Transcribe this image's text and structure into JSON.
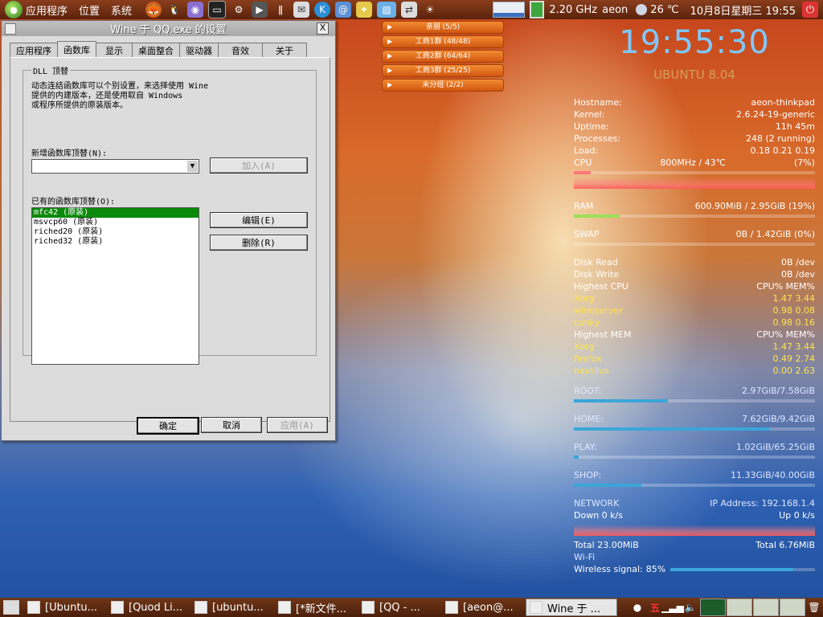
{
  "top_panel": {
    "menus": [
      "应用程序",
      "位置",
      "系统"
    ],
    "cpu_freq": "2.20 GHz",
    "user": "aeon",
    "temperature": "26 ℃",
    "datetime": "10月8日星期三 19:55"
  },
  "dialog": {
    "title": "Wine 于 QQ.exe 的设置",
    "close_label": "X",
    "tabs": [
      "应用程序",
      "函数库",
      "显示",
      "桌面整合",
      "驱动器",
      "音效",
      "关于"
    ],
    "group_label": "DLL 顶替",
    "description": [
      "动态连结函数库可以个别设置，来选择使用 Wine",
      "提供的内建版本，还是使用取自 Windows",
      "或程序所提供的原装版本。"
    ],
    "new_label": "新增函数库顶替(N):",
    "combo_value": "",
    "add_button": "加入(A)",
    "existing_label": "已有的函数库顶替(O):",
    "existing": [
      "mfc42 (原装)",
      "msvcp60 (原装)",
      "riched20 (原装)",
      "riched32 (原装)"
    ],
    "edit_button": "编辑(E)",
    "delete_button": "删除(R)",
    "ok_button": "确定",
    "cancel_button": "取消",
    "apply_button": "应用(A)"
  },
  "qq_groups": [
    "亲朋 (5/5)",
    "工商1群 (48/48)",
    "工商2群 (64/64)",
    "工商3群 (25/25)",
    "未分组 (2/2)"
  ],
  "conky": {
    "clock": "19:55:30",
    "distro": "UBUNTU 8.04",
    "hostname": {
      "label": "Hostname:",
      "value": "aeon-thinkpad"
    },
    "kernel": {
      "label": "Kernel:",
      "value": "2.6.24-19-generic"
    },
    "uptime": {
      "label": "Uptime:",
      "value": "11h 45m"
    },
    "processes": {
      "label": "Processes:",
      "value": "248 (2 running)"
    },
    "load": {
      "label": "Load:",
      "value": "0.18 0.21 0.19"
    },
    "cpu": {
      "label": "CPU",
      "value": "800MHz / 43℃",
      "percent": "(7%)",
      "level": 0.07
    },
    "ram": {
      "label": "RAM",
      "value": "600.90MiB / 2.95GiB (19%)",
      "level": 0.19
    },
    "swap": {
      "label": "SWAP",
      "value": "0B / 1.42GiB (0%)",
      "level": 0.0
    },
    "disk_read": {
      "label": "Disk Read",
      "value": "0B /dev"
    },
    "disk_write": {
      "label": "Disk Write",
      "value": "0B /dev"
    },
    "highest_cpu": {
      "label": "Highest CPU",
      "cols": "CPU% MEM%"
    },
    "cpu_procs": [
      {
        "name": "Xorg",
        "vals": "1.47  3.44"
      },
      {
        "name": "wineserver",
        "vals": "0.98  0.08"
      },
      {
        "name": "conky",
        "vals": "0.98  0.16"
      }
    ],
    "highest_mem": {
      "label": "Highest MEM",
      "cols": "CPU% MEM%"
    },
    "mem_procs": [
      {
        "name": "Xorg",
        "vals": "1.47  3.44"
      },
      {
        "name": "firefox",
        "vals": "0.49  2.74"
      },
      {
        "name": "nautilus",
        "vals": "0.00  2.63"
      }
    ],
    "disks": [
      {
        "label": "ROOT:",
        "value": "2.97GiB/7.58GiB",
        "level": 0.39
      },
      {
        "label": "HOME:",
        "value": "7.62GiB/9.42GiB",
        "level": 0.81
      },
      {
        "label": "PLAY:",
        "value": "1.02GiB/65.25GiB",
        "level": 0.02
      },
      {
        "label": "SHOP:",
        "value": "11.33GiB/40.00GiB",
        "level": 0.28
      }
    ],
    "network": {
      "label": "NETWORK",
      "ip_label": "IP Address:",
      "ip": "192.168.1.4",
      "down": "Down 0 k/s",
      "up_label": "Up",
      "up": "0 k/s",
      "total_down_label": "Total",
      "total_down": "23.00MiB",
      "total_up_label": "Total",
      "total_up": "6.76MiB",
      "wifi": "Wi-Fi",
      "signal_label": "Wireless signal:",
      "signal": "85%",
      "signal_level": 0.85
    }
  },
  "taskbar": {
    "tasks": [
      "[Ubuntu...",
      "[Quod Li...",
      "[ubuntu...",
      "[*新文件...",
      "[QQ - ...",
      "[aeon@...",
      "Wine 于 ..."
    ],
    "ime": "五"
  },
  "colors": {
    "accent": "#7fc8ff",
    "highlight": "#ffe34d",
    "bar": "#3aa6d8",
    "cpu_bar": "#ff7878",
    "ram_bar": "#9be05a"
  }
}
